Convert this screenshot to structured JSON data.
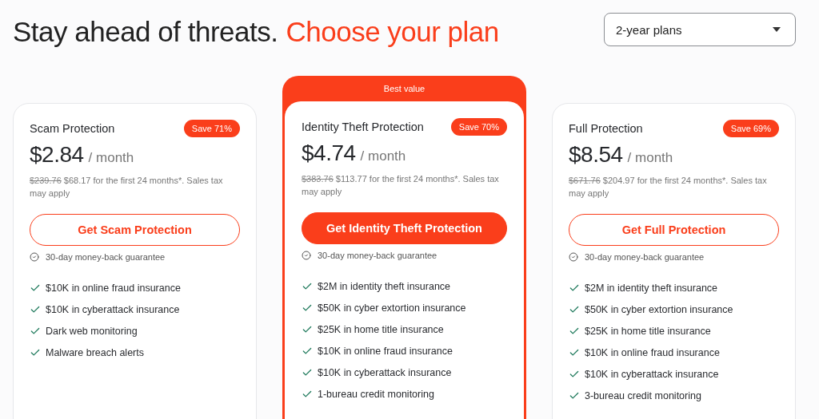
{
  "heading": {
    "lead": "Stay ahead of threats.",
    "accent": "Choose your plan"
  },
  "plan_select": {
    "value": "2-year plans"
  },
  "plans": [
    {
      "featured": false,
      "name": "Scam Protection",
      "badge": "Save 71%",
      "price": "$2.84",
      "period": "/ month",
      "old_price": "$239.76",
      "note": "$68.17 for the first 24 months*. Sales tax may apply",
      "button": "Get Scam Protection",
      "guarantee": "30-day money-back guarantee",
      "features": [
        "$10K in online fraud insurance",
        "$10K in cyberattack insurance",
        "Dark web monitoring",
        "Malware breach alerts"
      ]
    },
    {
      "featured": true,
      "banner": "Best value",
      "name": "Identity Theft Protection",
      "badge": "Save 70%",
      "price": "$4.74",
      "period": "/ month",
      "old_price": "$383.76",
      "note": "$113.77 for the first 24 months*. Sales tax may apply",
      "button": "Get Identity Theft Protection",
      "guarantee": "30-day money-back guarantee",
      "features": [
        "$2M in identity theft insurance",
        "$50K in cyber extortion insurance",
        "$25K in home title insurance",
        "$10K in online fraud insurance",
        "$10K in cyberattack insurance",
        "1-bureau credit monitoring"
      ]
    },
    {
      "featured": false,
      "name": "Full Protection",
      "badge": "Save 69%",
      "price": "$8.54",
      "period": "/ month",
      "old_price": "$671.76",
      "note": "$204.97 for the first 24 months*. Sales tax may apply",
      "button": "Get Full Protection",
      "guarantee": "30-day money-back guarantee",
      "features": [
        "$2M in identity theft insurance",
        "$50K in cyber extortion insurance",
        "$25K in home title insurance",
        "$10K in online fraud insurance",
        "$10K in cyberattack insurance",
        "3-bureau credit monitoring"
      ]
    }
  ]
}
